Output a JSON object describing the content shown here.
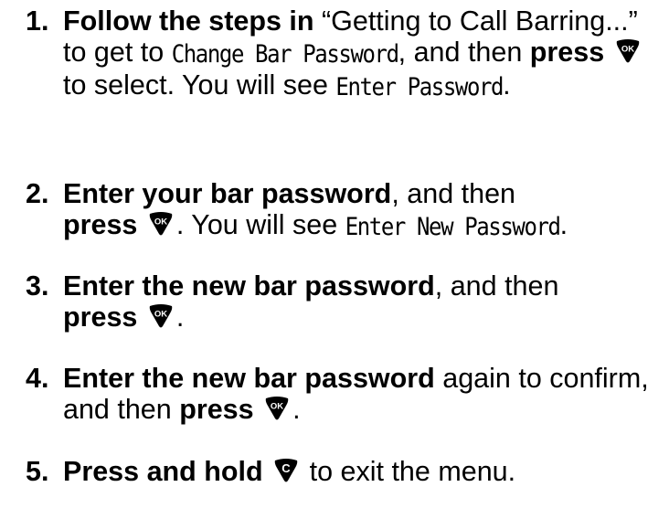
{
  "steps": [
    {
      "number": "1.",
      "lead": "Follow the steps in",
      "t1": " “Getting to Call Barring...” to get to ",
      "screen1": "Change Bar Password",
      "t2": ", and then ",
      "press": "press",
      "t3": " to select. You will see ",
      "screen2": "Enter Password",
      "t4": ".",
      "key": "ok-key-icon"
    },
    {
      "number": "2.",
      "lead": "Enter your bar password",
      "t1": ", and then",
      "press": "press",
      "t2": ". You will see ",
      "screen1": "Enter New Password",
      "t3": ".",
      "key": "ok-key-icon"
    },
    {
      "number": "3.",
      "lead": "Enter the new bar password",
      "t1": ", and then",
      "press": "press",
      "t2": ".",
      "key": "ok-key-icon"
    },
    {
      "number": "4.",
      "lead": "Enter the new bar password",
      "t1": " again to confirm, and then ",
      "press": "press",
      "t2": ".",
      "key": "ok-key-icon"
    },
    {
      "number": "5.",
      "lead": "Press and hold",
      "t1": " to exit the menu.",
      "key": "clear-key-icon"
    }
  ],
  "keys": {
    "ok_label": "OK",
    "clear_label": "C",
    "color": "#000000"
  }
}
